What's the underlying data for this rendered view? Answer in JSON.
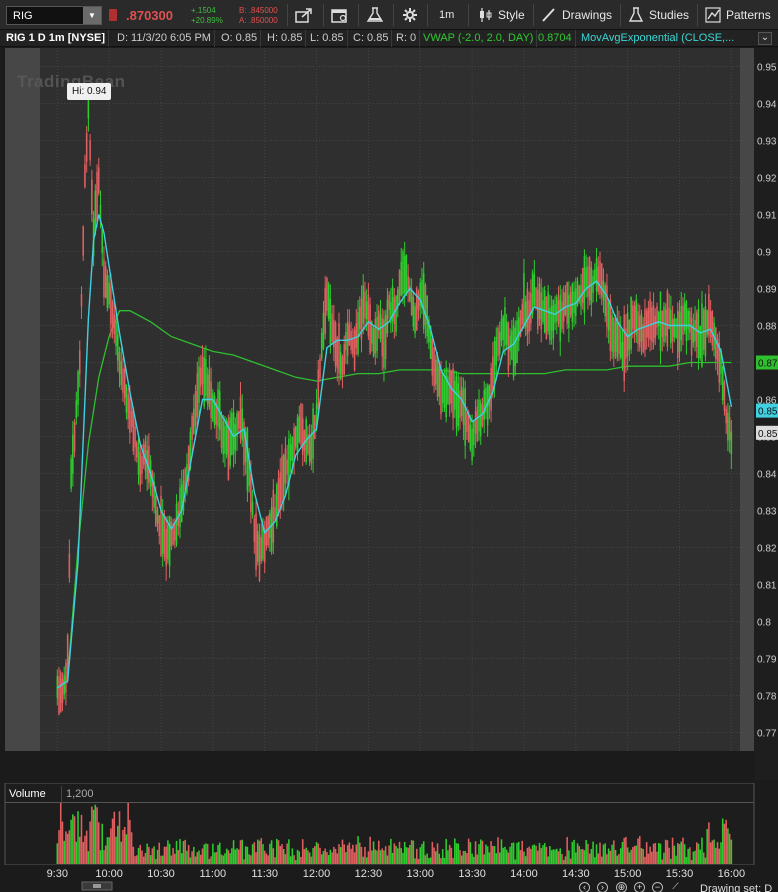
{
  "toolbar": {
    "symbol": "RIG",
    "last_price": ".870300",
    "change_abs": "+.1504",
    "change_pct": "+20.89%",
    "bid": "B: .845000",
    "ask": "A: .850000",
    "aggregation": "1m",
    "style_label": "Style",
    "drawings_label": "Drawings",
    "studies_label": "Studies",
    "patterns_label": "Patterns"
  },
  "status": {
    "title": "RIG 1 D 1m [NYSE]",
    "date": "D: 11/3/20 6:05 PM",
    "open": "O: 0.85",
    "high": "H: 0.85",
    "low": "L: 0.85",
    "close": "C: 0.85",
    "range": "R: 0",
    "vwap_label": "VWAP (-2.0, 2.0, DAY)",
    "vwap_value": "0.8704",
    "mavg_label": "MovAvgExponential (CLOSE,..."
  },
  "chart": {
    "watermark": "TradingBean",
    "hi_label": "Hi: 0.94",
    "volume_label": "Volume",
    "volume_scale": "1,200",
    "drawing_set_label": "Drawing set: D",
    "colors": {
      "up": "#2ecc2e",
      "down": "#e06060",
      "vwap": "#2fbf2f",
      "ema": "#40d0e0",
      "background": "#2f2f2f",
      "grid": "#444444"
    }
  },
  "chart_data": {
    "type": "candlestick",
    "y_ticks": [
      "0.95",
      "0.94",
      "0.93",
      "0.92",
      "0.91",
      "0.9",
      "0.89",
      "0.88",
      "0.87",
      "0.86",
      "0.85",
      "0.84",
      "0.83",
      "0.82",
      "0.81",
      "0.8",
      "0.79",
      "0.78",
      "0.77"
    ],
    "x_ticks": [
      "9:30",
      "10:00",
      "10:30",
      "11:00",
      "11:30",
      "12:00",
      "12:30",
      "13:00",
      "13:30",
      "14:00",
      "14:30",
      "15:00",
      "15:30",
      "16:00"
    ],
    "ylim": [
      0.765,
      0.955
    ],
    "xlim": [
      "9:20",
      "16:05"
    ],
    "price_markers": [
      {
        "label": "0.87",
        "value": 0.87,
        "color": "#2fbf2f"
      },
      {
        "label": "0.85",
        "value": 0.857,
        "color": "#40d0e0"
      },
      {
        "label": "0.85",
        "value": 0.851,
        "color": "#dddddd"
      }
    ],
    "high": 0.94,
    "price_path": [
      [
        "9:30",
        0.782
      ],
      [
        "9:33",
        0.78
      ],
      [
        "9:36",
        0.79
      ],
      [
        "9:38",
        0.84
      ],
      [
        "9:40",
        0.85
      ],
      [
        "9:43",
        0.87
      ],
      [
        "9:46",
        0.92
      ],
      [
        "9:48",
        0.94
      ],
      [
        "9:51",
        0.905
      ],
      [
        "9:54",
        0.92
      ],
      [
        "9:57",
        0.893
      ],
      [
        "10:00",
        0.89
      ],
      [
        "10:03",
        0.88
      ],
      [
        "10:06",
        0.87
      ],
      [
        "10:09",
        0.864
      ],
      [
        "10:12",
        0.856
      ],
      [
        "10:15",
        0.85
      ],
      [
        "10:18",
        0.84
      ],
      [
        "10:21",
        0.846
      ],
      [
        "10:24",
        0.84
      ],
      [
        "10:27",
        0.83
      ],
      [
        "10:30",
        0.825
      ],
      [
        "10:33",
        0.82
      ],
      [
        "10:36",
        0.823
      ],
      [
        "10:39",
        0.826
      ],
      [
        "10:42",
        0.832
      ],
      [
        "10:45",
        0.84
      ],
      [
        "10:48",
        0.851
      ],
      [
        "10:51",
        0.861
      ],
      [
        "10:54",
        0.868
      ],
      [
        "10:57",
        0.862
      ],
      [
        "11:00",
        0.858
      ],
      [
        "11:03",
        0.856
      ],
      [
        "11:06",
        0.852
      ],
      [
        "11:09",
        0.846
      ],
      [
        "11:12",
        0.85
      ],
      [
        "11:15",
        0.855
      ],
      [
        "11:18",
        0.851
      ],
      [
        "11:21",
        0.84
      ],
      [
        "11:24",
        0.826
      ],
      [
        "11:27",
        0.817
      ],
      [
        "11:30",
        0.822
      ],
      [
        "11:33",
        0.826
      ],
      [
        "11:36",
        0.829
      ],
      [
        "11:39",
        0.836
      ],
      [
        "11:42",
        0.84
      ],
      [
        "11:45",
        0.846
      ],
      [
        "11:48",
        0.85
      ],
      [
        "11:51",
        0.852
      ],
      [
        "11:54",
        0.846
      ],
      [
        "11:57",
        0.848
      ],
      [
        "12:00",
        0.856
      ],
      [
        "12:03",
        0.875
      ],
      [
        "12:06",
        0.889
      ],
      [
        "12:09",
        0.88
      ],
      [
        "12:12",
        0.872
      ],
      [
        "12:15",
        0.869
      ],
      [
        "12:18",
        0.878
      ],
      [
        "12:21",
        0.874
      ],
      [
        "12:24",
        0.879
      ],
      [
        "12:27",
        0.886
      ],
      [
        "12:30",
        0.882
      ],
      [
        "12:33",
        0.875
      ],
      [
        "12:36",
        0.88
      ],
      [
        "12:39",
        0.876
      ],
      [
        "12:42",
        0.886
      ],
      [
        "12:45",
        0.883
      ],
      [
        "12:48",
        0.89
      ],
      [
        "12:51",
        0.895
      ],
      [
        "12:54",
        0.889
      ],
      [
        "12:57",
        0.882
      ],
      [
        "13:00",
        0.888
      ],
      [
        "13:03",
        0.886
      ],
      [
        "13:06",
        0.876
      ],
      [
        "13:09",
        0.866
      ],
      [
        "13:12",
        0.864
      ],
      [
        "13:15",
        0.863
      ],
      [
        "13:18",
        0.862
      ],
      [
        "13:21",
        0.86
      ],
      [
        "13:24",
        0.858
      ],
      [
        "13:27",
        0.854
      ],
      [
        "13:30",
        0.85
      ],
      [
        "13:33",
        0.855
      ],
      [
        "13:36",
        0.857
      ],
      [
        "13:39",
        0.86
      ],
      [
        "13:42",
        0.866
      ],
      [
        "13:45",
        0.874
      ],
      [
        "13:48",
        0.88
      ],
      [
        "13:51",
        0.876
      ],
      [
        "13:54",
        0.873
      ],
      [
        "13:57",
        0.879
      ],
      [
        "14:00",
        0.885
      ],
      [
        "14:03",
        0.882
      ],
      [
        "14:06",
        0.889
      ],
      [
        "14:09",
        0.885
      ],
      [
        "14:12",
        0.883
      ],
      [
        "14:15",
        0.881
      ],
      [
        "14:18",
        0.884
      ],
      [
        "14:21",
        0.882
      ],
      [
        "14:24",
        0.886
      ],
      [
        "14:27",
        0.885
      ],
      [
        "14:30",
        0.887
      ],
      [
        "14:33",
        0.889
      ],
      [
        "14:36",
        0.892
      ],
      [
        "14:39",
        0.89
      ],
      [
        "14:42",
        0.895
      ],
      [
        "14:45",
        0.891
      ],
      [
        "14:48",
        0.885
      ],
      [
        "14:51",
        0.878
      ],
      [
        "14:54",
        0.878
      ],
      [
        "14:57",
        0.873
      ],
      [
        "15:00",
        0.877
      ],
      [
        "15:03",
        0.881
      ],
      [
        "15:06",
        0.88
      ],
      [
        "15:09",
        0.878
      ],
      [
        "15:12",
        0.882
      ],
      [
        "15:15",
        0.88
      ],
      [
        "15:18",
        0.882
      ],
      [
        "15:21",
        0.879
      ],
      [
        "15:24",
        0.881
      ],
      [
        "15:27",
        0.879
      ],
      [
        "15:30",
        0.88
      ],
      [
        "15:33",
        0.882
      ],
      [
        "15:36",
        0.88
      ],
      [
        "15:39",
        0.878
      ],
      [
        "15:42",
        0.876
      ],
      [
        "15:45",
        0.879
      ],
      [
        "15:48",
        0.881
      ],
      [
        "15:51",
        0.876
      ],
      [
        "15:54",
        0.87
      ],
      [
        "15:57",
        0.856
      ],
      [
        "16:00",
        0.848
      ]
    ],
    "ema_path": [
      [
        "9:30",
        0.782
      ],
      [
        "9:36",
        0.784
      ],
      [
        "9:42",
        0.816
      ],
      [
        "9:48",
        0.882
      ],
      [
        "9:51",
        0.903
      ],
      [
        "9:54",
        0.91
      ],
      [
        "9:57",
        0.905
      ],
      [
        "10:00",
        0.896
      ],
      [
        "10:06",
        0.878
      ],
      [
        "10:12",
        0.862
      ],
      [
        "10:18",
        0.848
      ],
      [
        "10:24",
        0.84
      ],
      [
        "10:30",
        0.83
      ],
      [
        "10:36",
        0.825
      ],
      [
        "10:42",
        0.83
      ],
      [
        "10:48",
        0.845
      ],
      [
        "10:54",
        0.86
      ],
      [
        "11:00",
        0.86
      ],
      [
        "11:06",
        0.855
      ],
      [
        "11:12",
        0.85
      ],
      [
        "11:18",
        0.852
      ],
      [
        "11:24",
        0.835
      ],
      [
        "11:30",
        0.824
      ],
      [
        "11:36",
        0.827
      ],
      [
        "11:42",
        0.834
      ],
      [
        "11:48",
        0.845
      ],
      [
        "11:54",
        0.849
      ],
      [
        "12:00",
        0.852
      ],
      [
        "12:06",
        0.874
      ],
      [
        "12:12",
        0.876
      ],
      [
        "12:18",
        0.876
      ],
      [
        "12:24",
        0.877
      ],
      [
        "12:30",
        0.881
      ],
      [
        "12:36",
        0.879
      ],
      [
        "12:42",
        0.881
      ],
      [
        "12:48",
        0.886
      ],
      [
        "12:54",
        0.89
      ],
      [
        "13:00",
        0.887
      ],
      [
        "13:06",
        0.879
      ],
      [
        "13:12",
        0.868
      ],
      [
        "13:18",
        0.863
      ],
      [
        "13:24",
        0.86
      ],
      [
        "13:30",
        0.854
      ],
      [
        "13:36",
        0.856
      ],
      [
        "13:42",
        0.862
      ],
      [
        "13:48",
        0.873
      ],
      [
        "13:54",
        0.875
      ],
      [
        "14:00",
        0.88
      ],
      [
        "14:06",
        0.885
      ],
      [
        "14:12",
        0.884
      ],
      [
        "14:18",
        0.883
      ],
      [
        "14:24",
        0.885
      ],
      [
        "14:30",
        0.886
      ],
      [
        "14:36",
        0.89
      ],
      [
        "14:42",
        0.892
      ],
      [
        "14:48",
        0.888
      ],
      [
        "14:54",
        0.881
      ],
      [
        "15:00",
        0.877
      ],
      [
        "15:06",
        0.879
      ],
      [
        "15:12",
        0.88
      ],
      [
        "15:18",
        0.881
      ],
      [
        "15:24",
        0.88
      ],
      [
        "15:30",
        0.88
      ],
      [
        "15:36",
        0.88
      ],
      [
        "15:42",
        0.878
      ],
      [
        "15:48",
        0.879
      ],
      [
        "15:54",
        0.873
      ],
      [
        "16:00",
        0.858
      ]
    ],
    "vwap_path": [
      [
        "9:30",
        0.782
      ],
      [
        "9:36",
        0.785
      ],
      [
        "9:42",
        0.82
      ],
      [
        "9:48",
        0.848
      ],
      [
        "9:54",
        0.866
      ],
      [
        "10:00",
        0.877
      ],
      [
        "10:06",
        0.884
      ],
      [
        "10:12",
        0.884
      ],
      [
        "10:24",
        0.881
      ],
      [
        "10:36",
        0.877
      ],
      [
        "10:48",
        0.875
      ],
      [
        "11:00",
        0.873
      ],
      [
        "11:12",
        0.872
      ],
      [
        "11:24",
        0.87
      ],
      [
        "11:36",
        0.868
      ],
      [
        "11:48",
        0.866
      ],
      [
        "12:00",
        0.865
      ],
      [
        "12:12",
        0.866
      ],
      [
        "12:24",
        0.867
      ],
      [
        "12:36",
        0.867
      ],
      [
        "12:48",
        0.868
      ],
      [
        "13:00",
        0.868
      ],
      [
        "13:12",
        0.868
      ],
      [
        "13:24",
        0.867
      ],
      [
        "13:36",
        0.867
      ],
      [
        "13:48",
        0.867
      ],
      [
        "14:00",
        0.867
      ],
      [
        "14:12",
        0.867
      ],
      [
        "14:24",
        0.868
      ],
      [
        "14:36",
        0.868
      ],
      [
        "14:48",
        0.868
      ],
      [
        "15:00",
        0.869
      ],
      [
        "15:12",
        0.869
      ],
      [
        "15:24",
        0.869
      ],
      [
        "15:36",
        0.87
      ],
      [
        "15:48",
        0.87
      ],
      [
        "16:00",
        0.87
      ]
    ]
  }
}
